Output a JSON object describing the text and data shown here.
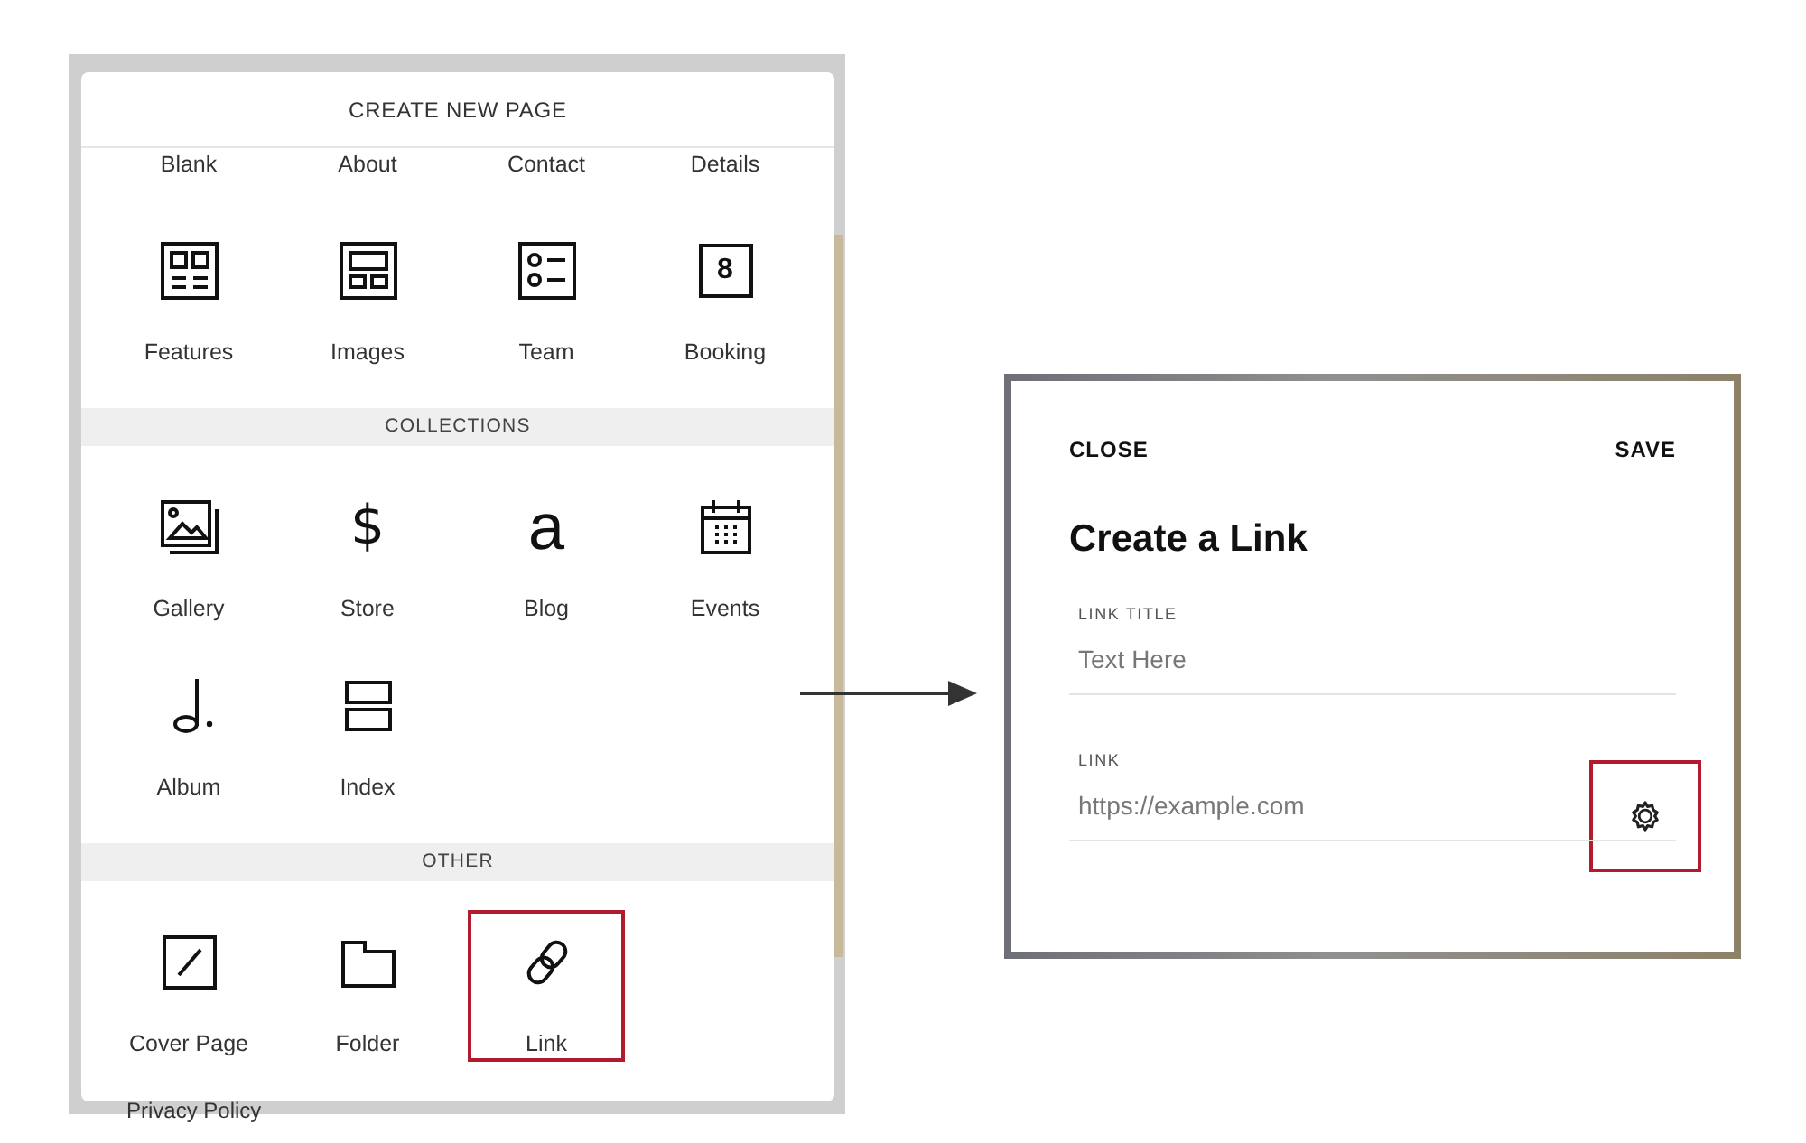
{
  "create_page": {
    "title": "CREATE NEW PAGE",
    "sections": [
      {
        "items": [
          {
            "kind": "cut",
            "label": "Blank",
            "highlighted": false
          },
          {
            "kind": "cut",
            "label": "About",
            "highlighted": false
          },
          {
            "kind": "cut",
            "label": "Contact",
            "highlighted": false
          },
          {
            "kind": "cut",
            "label": "Details",
            "highlighted": false
          },
          {
            "kind": "tile",
            "label": "Features",
            "highlighted": false
          },
          {
            "kind": "tile",
            "label": "Images",
            "highlighted": false
          },
          {
            "kind": "tile",
            "label": "Team",
            "highlighted": false
          },
          {
            "kind": "tile",
            "label": "Booking",
            "icon_text": "8",
            "highlighted": false
          }
        ]
      },
      {
        "heading": "COLLECTIONS",
        "items": [
          {
            "kind": "tile",
            "label": "Gallery",
            "highlighted": false
          },
          {
            "kind": "tile",
            "label": "Store",
            "icon_text": "$",
            "highlighted": false
          },
          {
            "kind": "tile",
            "label": "Blog",
            "icon_text": "a",
            "highlighted": false
          },
          {
            "kind": "tile",
            "label": "Events",
            "highlighted": false
          },
          {
            "kind": "tile",
            "label": "Album",
            "highlighted": false
          },
          {
            "kind": "tile",
            "label": "Index",
            "highlighted": false
          }
        ]
      },
      {
        "heading": "OTHER",
        "items": [
          {
            "kind": "tile",
            "label": "Cover Page",
            "highlighted": false
          },
          {
            "kind": "tile",
            "label": "Folder",
            "highlighted": false
          },
          {
            "kind": "tile",
            "label": "Link",
            "highlighted": true
          }
        ]
      }
    ]
  },
  "background_text": "Privacy Policy",
  "dialog": {
    "close": "CLOSE",
    "save": "SAVE",
    "title": "Create a Link",
    "fields": [
      {
        "label": "LINK TITLE",
        "placeholder": "Text Here",
        "settings": false
      },
      {
        "label": "LINK",
        "placeholder": "https://example.com",
        "settings": true,
        "settings_highlighted": true
      }
    ]
  }
}
